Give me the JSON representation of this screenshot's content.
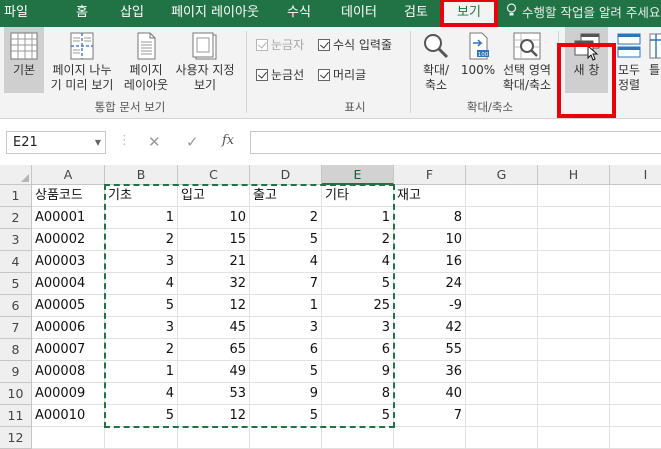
{
  "tabs": [
    "파일",
    "홈",
    "삽입",
    "페이지 레이아웃",
    "수식",
    "데이터",
    "검토",
    "보기"
  ],
  "active_tab": "보기",
  "tell_me": "수행할 작업을 알려 주세요",
  "ribbon": {
    "normal": "기본",
    "page_break": "페이지 나누\n기 미리 보기",
    "page_layout": "페이지\n레이아웃",
    "custom_views": "사용자 지정\n보기",
    "group_workbook_views": "통합 문서 보기",
    "ruler": "눈금자",
    "formula_bar": "수식 입력줄",
    "gridlines": "눈금선",
    "headings": "머리글",
    "group_show": "표시",
    "zoom": "확대/\n축소",
    "zoom100": "100%",
    "zoom_selection": "선택 영역\n확대/축소",
    "group_zoom": "확대/축소",
    "new_window": "새 창",
    "arrange_all": "모두\n정렬",
    "freeze_partial": "틀"
  },
  "formula_bar": {
    "name_box": "E21",
    "cancel": "✕",
    "enter": "✓",
    "fx": "fx",
    "value": ""
  },
  "columns": [
    "A",
    "B",
    "C",
    "D",
    "E",
    "F",
    "G",
    "H",
    "I"
  ],
  "selected_column": "E",
  "rows": [
    [
      "상품코드",
      "기초",
      "입고",
      "출고",
      "기타",
      "재고"
    ],
    [
      "A00001",
      "1",
      "10",
      "2",
      "1",
      "8"
    ],
    [
      "A00002",
      "2",
      "15",
      "5",
      "2",
      "10"
    ],
    [
      "A00003",
      "3",
      "21",
      "4",
      "4",
      "16"
    ],
    [
      "A00004",
      "4",
      "32",
      "7",
      "5",
      "24"
    ],
    [
      "A00005",
      "5",
      "12",
      "1",
      "25",
      "-9"
    ],
    [
      "A00006",
      "3",
      "45",
      "3",
      "3",
      "42"
    ],
    [
      "A00007",
      "2",
      "65",
      "6",
      "6",
      "55"
    ],
    [
      "A00008",
      "1",
      "49",
      "5",
      "9",
      "36"
    ],
    [
      "A00009",
      "4",
      "53",
      "9",
      "8",
      "40"
    ],
    [
      "A00010",
      "5",
      "12",
      "5",
      "5",
      "7"
    ],
    [
      "",
      "",
      "",
      "",
      "",
      ""
    ]
  ],
  "row_numbers": [
    "1",
    "2",
    "3",
    "4",
    "5",
    "6",
    "7",
    "8",
    "9",
    "10",
    "11",
    "12"
  ],
  "colors": {
    "excel_green": "#217346",
    "highlight_red": "#e8000b"
  }
}
